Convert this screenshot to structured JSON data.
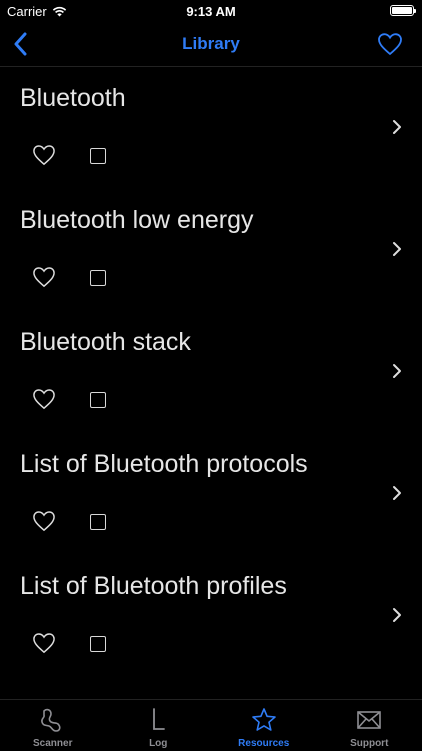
{
  "status_bar": {
    "carrier": "Carrier",
    "time": "9:13 AM"
  },
  "nav": {
    "title": "Library",
    "back_icon": "chevron-left-icon",
    "favorite_icon": "heart-icon"
  },
  "colors": {
    "accent": "#2f7cf6",
    "background": "#000000",
    "inactive": "#8e8e93"
  },
  "items": [
    {
      "title": "Bluetooth"
    },
    {
      "title": "Bluetooth low energy"
    },
    {
      "title": "Bluetooth stack"
    },
    {
      "title": "List of Bluetooth protocols"
    },
    {
      "title": "List of Bluetooth profiles"
    }
  ],
  "tabs": [
    {
      "label": "Scanner",
      "icon": "scanner-icon",
      "active": false
    },
    {
      "label": "Log",
      "icon": "log-icon",
      "active": false
    },
    {
      "label": "Resources",
      "icon": "star-icon",
      "active": true
    },
    {
      "label": "Support",
      "icon": "envelope-icon",
      "active": false
    }
  ]
}
